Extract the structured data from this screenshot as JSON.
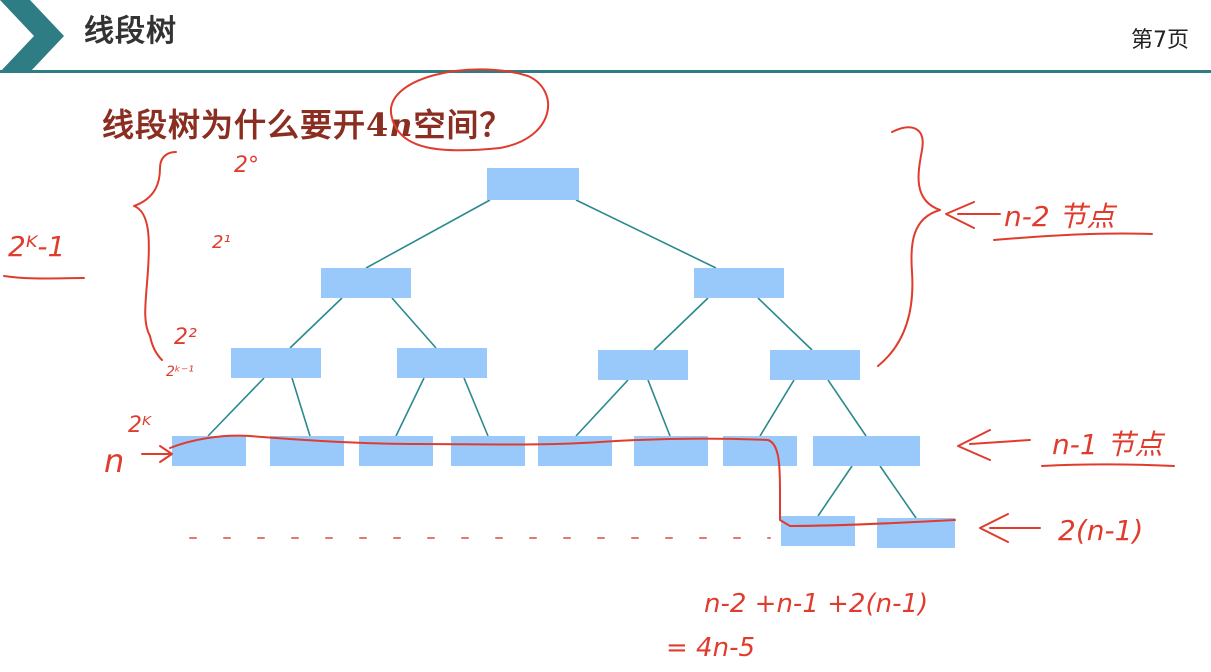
{
  "header": {
    "title": "线段树",
    "page_number": "第7页"
  },
  "question": {
    "prefix": "线段树为什么要开",
    "n_coefficient": "4",
    "n_var": "n",
    "suffix": "空间？"
  },
  "colors": {
    "accent": "#2e7d84",
    "node_fill": "#99c9fb",
    "edge": "#2a8a8f",
    "annotation_ink": "#e03c2e",
    "question_text": "#8b2e22"
  },
  "annotations": {
    "level_0": "2°",
    "level_1": "2¹",
    "level_2": "2²",
    "level_k": "2ᵏ⁻¹",
    "level_leaf": "2ᴷ",
    "total_nodes": "2ᴷ-1",
    "leaf_count": "n",
    "internal_nodes": "n-2 节点",
    "leaf_nodes": "n-1 节点",
    "extra_nodes": "2(n-1)",
    "sum_line": "n-2 +n-1  +2(n-1)",
    "result_line": "= 4n-5"
  },
  "icons": {
    "header_chevron": "chevron-right-icon"
  }
}
